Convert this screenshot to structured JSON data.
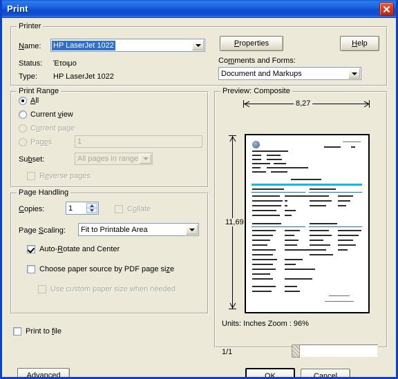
{
  "window": {
    "title": "Print",
    "close_icon": "close-icon"
  },
  "printer": {
    "group_title": "Printer",
    "name_label": "Name:",
    "name_value": "HP LaserJet 1022",
    "status_label": "Status:",
    "status_value": "Έτοιμο",
    "type_label": "Type:",
    "type_value": "HP LaserJet 1022",
    "properties_button": "Properties",
    "help_button": "Help",
    "comments_label": "Comments and Forms:",
    "comments_value": "Document and Markups"
  },
  "print_range": {
    "group_title": "Print Range",
    "all_label": "All",
    "current_view_label": "Current view",
    "current_page_label": "Current page",
    "pages_label": "Pages",
    "pages_value": "1",
    "subset_label": "Subset:",
    "subset_value": "All pages in range",
    "reverse_label": "Reverse pages",
    "selected": "all"
  },
  "page_handling": {
    "group_title": "Page Handling",
    "copies_label": "Copies:",
    "copies_value": "1",
    "collate_label": "Collate",
    "collate_checked": false,
    "scaling_label": "Page Scaling:",
    "scaling_value": "Fit to Printable Area",
    "autorotate_label": "Auto-Rotate and Center",
    "autorotate_checked": true,
    "papersource_label": "Choose paper source by PDF page size",
    "papersource_checked": false,
    "customsize_label": "Use custom paper size when needed",
    "customsize_checked": false
  },
  "preview": {
    "group_title": "Preview: Composite",
    "width_dimension": "8,27",
    "height_dimension": "11,69",
    "units_zoom": "Units: Inches Zoom :  96%",
    "page_indicator": "1/1"
  },
  "footer": {
    "print_to_file_label": "Print to file",
    "print_to_file_checked": false,
    "advanced_button": "Advanced",
    "ok_button": "OK",
    "cancel_button": "Cancel"
  },
  "colors": {
    "dialog_face": "#ECE9D8",
    "title_blue": "#0A4BD0",
    "selection_blue": "#2F6FD0",
    "close_red": "#D4402A",
    "preview_accent": "#18B6E8"
  }
}
